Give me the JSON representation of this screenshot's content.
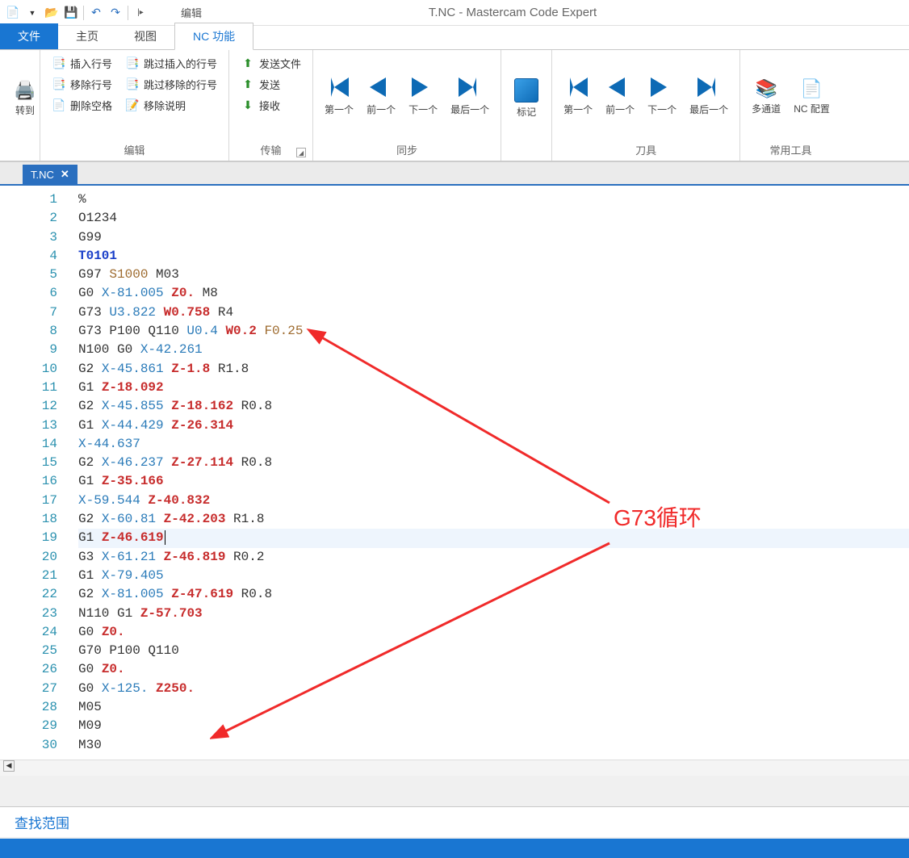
{
  "window": {
    "title": "T.NC - Mastercam Code Expert"
  },
  "qat": {
    "edit_tab": "编辑"
  },
  "tabs": {
    "file": "文件",
    "home": "主页",
    "view": "视图",
    "ncfunc": "NC 功能"
  },
  "ribbon": {
    "goto": "转到",
    "edit_group": "编辑",
    "insert_ln": "插入行号",
    "remove_ln": "移除行号",
    "del_space": "删除空格",
    "skip_insert": "跳过插入的行号",
    "skip_remove": "跳过移除的行号",
    "remove_desc": "移除说明",
    "trans_group": "传输",
    "send_file": "发送文件",
    "send": "发送",
    "recv": "接收",
    "sync_group": "同步",
    "first": "第一个",
    "prev": "前一个",
    "next": "下一个",
    "last": "最后一个",
    "mark": "标记",
    "tool_group": "刀具",
    "t_first": "第一个",
    "t_prev": "前一个",
    "t_next": "下一个",
    "t_last": "最后一个",
    "util_group": "常用工具",
    "multi": "多通道",
    "cfg": "NC 配置"
  },
  "file_tab": {
    "name": "T.NC",
    "close": "✕"
  },
  "code": {
    "lines": [
      {
        "n": 1,
        "t": [
          [
            "k",
            "%"
          ]
        ]
      },
      {
        "n": 2,
        "t": [
          [
            "k",
            "O1234"
          ]
        ]
      },
      {
        "n": 3,
        "t": [
          [
            "k",
            "G99"
          ]
        ]
      },
      {
        "n": 4,
        "t": [
          [
            "b",
            "T0101"
          ]
        ]
      },
      {
        "n": 5,
        "t": [
          [
            "k",
            "G97 "
          ],
          [
            "s",
            "S1000"
          ],
          [
            "k",
            " M03"
          ]
        ]
      },
      {
        "n": 6,
        "t": [
          [
            "g",
            "G0 "
          ],
          [
            "x",
            "X-81.005 "
          ],
          [
            "z",
            "Z0."
          ],
          [
            "k",
            " M8"
          ]
        ]
      },
      {
        "n": 7,
        "t": [
          [
            "k",
            "G73 "
          ],
          [
            "u",
            "U3.822 "
          ],
          [
            "w",
            "W0.758"
          ],
          [
            "k",
            " R4"
          ]
        ]
      },
      {
        "n": 8,
        "t": [
          [
            "k",
            "G73 P100 Q110 "
          ],
          [
            "u",
            "U0.4 "
          ],
          [
            "w",
            "W0.2"
          ],
          [
            "k",
            " "
          ],
          [
            "f",
            "F0.25"
          ]
        ]
      },
      {
        "n": 9,
        "t": [
          [
            "k",
            "N100 "
          ],
          [
            "g",
            "G0 "
          ],
          [
            "x",
            "X-42.261"
          ]
        ]
      },
      {
        "n": 10,
        "t": [
          [
            "g",
            "G2 "
          ],
          [
            "x",
            "X-45.861 "
          ],
          [
            "z",
            "Z-1.8"
          ],
          [
            "k",
            " R1.8"
          ]
        ]
      },
      {
        "n": 11,
        "t": [
          [
            "g",
            "G1 "
          ],
          [
            "z",
            "Z-18.092"
          ]
        ]
      },
      {
        "n": 12,
        "t": [
          [
            "g",
            "G2 "
          ],
          [
            "x",
            "X-45.855 "
          ],
          [
            "z",
            "Z-18.162"
          ],
          [
            "k",
            " R0.8"
          ]
        ]
      },
      {
        "n": 13,
        "t": [
          [
            "g",
            "G1 "
          ],
          [
            "x",
            "X-44.429 "
          ],
          [
            "z",
            "Z-26.314"
          ]
        ]
      },
      {
        "n": 14,
        "t": [
          [
            "x",
            "X-44.637"
          ]
        ]
      },
      {
        "n": 15,
        "t": [
          [
            "g",
            "G2 "
          ],
          [
            "x",
            "X-46.237 "
          ],
          [
            "z",
            "Z-27.114"
          ],
          [
            "k",
            " R0.8"
          ]
        ]
      },
      {
        "n": 16,
        "t": [
          [
            "g",
            "G1 "
          ],
          [
            "z",
            "Z-35.166"
          ]
        ]
      },
      {
        "n": 17,
        "t": [
          [
            "x",
            "X-59.544 "
          ],
          [
            "z",
            "Z-40.832"
          ]
        ]
      },
      {
        "n": 18,
        "t": [
          [
            "g",
            "G2 "
          ],
          [
            "x",
            "X-60.81 "
          ],
          [
            "z",
            "Z-42.203"
          ],
          [
            "k",
            " R1.8"
          ]
        ]
      },
      {
        "n": 19,
        "hl": true,
        "cursor": true,
        "t": [
          [
            "g",
            "G1 "
          ],
          [
            "z",
            "Z-46.619"
          ]
        ]
      },
      {
        "n": 20,
        "t": [
          [
            "g",
            "G3 "
          ],
          [
            "x",
            "X-61.21 "
          ],
          [
            "z",
            "Z-46.819"
          ],
          [
            "k",
            " R0.2"
          ]
        ]
      },
      {
        "n": 21,
        "t": [
          [
            "g",
            "G1 "
          ],
          [
            "x",
            "X-79.405"
          ]
        ]
      },
      {
        "n": 22,
        "t": [
          [
            "g",
            "G2 "
          ],
          [
            "x",
            "X-81.005 "
          ],
          [
            "z",
            "Z-47.619"
          ],
          [
            "k",
            " R0.8"
          ]
        ]
      },
      {
        "n": 23,
        "t": [
          [
            "k",
            "N110 "
          ],
          [
            "g",
            "G1 "
          ],
          [
            "z",
            "Z-57.703"
          ]
        ]
      },
      {
        "n": 24,
        "t": [
          [
            "g",
            "G0 "
          ],
          [
            "z",
            "Z0."
          ]
        ]
      },
      {
        "n": 25,
        "t": [
          [
            "k",
            "G70 P100 Q110"
          ]
        ]
      },
      {
        "n": 26,
        "t": [
          [
            "g",
            "G0 "
          ],
          [
            "z",
            "Z0."
          ]
        ]
      },
      {
        "n": 27,
        "t": [
          [
            "g",
            "G0 "
          ],
          [
            "x",
            "X-125. "
          ],
          [
            "z",
            "Z250."
          ]
        ]
      },
      {
        "n": 28,
        "t": [
          [
            "k",
            "M05"
          ]
        ]
      },
      {
        "n": 29,
        "t": [
          [
            "k",
            "M09"
          ]
        ]
      },
      {
        "n": 30,
        "t": [
          [
            "k",
            "M30"
          ]
        ]
      }
    ]
  },
  "annotation": {
    "label": "G73循环"
  },
  "find": {
    "label": "查找范围"
  }
}
